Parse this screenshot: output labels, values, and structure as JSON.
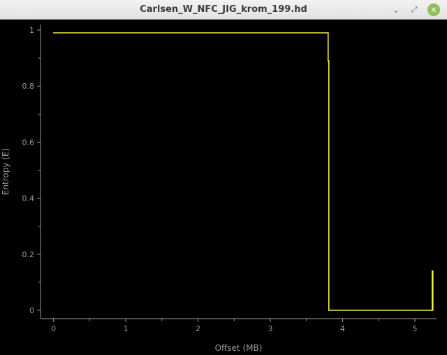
{
  "window": {
    "title": "Carlsen_W_NFC_JIG_krom_199.hd",
    "minimize_glyph": "⌄",
    "maximize_glyph": "⤢",
    "close_glyph": "✕"
  },
  "colors": {
    "background": "#000000",
    "axis": "#9a9a9a",
    "text": "#9a9a9a",
    "series": "#f2ec3c",
    "close_button": "#8fbf55"
  },
  "chart_data": {
    "type": "line",
    "title": "",
    "xlabel": "Offset (MB)",
    "ylabel": "Entropy (E)",
    "xlim": [
      -0.18,
      5.3
    ],
    "ylim": [
      -0.03,
      1.02
    ],
    "x_ticks": [
      0,
      1,
      2,
      3,
      4,
      5
    ],
    "x_tick_labels": [
      "0",
      "1",
      "2",
      "3",
      "4",
      "5"
    ],
    "y_ticks": [
      0,
      0.2,
      0.4,
      0.6,
      0.8,
      1
    ],
    "y_tick_labels": [
      "0",
      "0.2",
      "0.4",
      "0.6",
      "0.8",
      "1"
    ],
    "grid": false,
    "legend": "none",
    "series": [
      {
        "x": [
          0,
          3.8,
          3.8,
          3.81,
          3.81,
          5.24,
          5.24,
          5.25,
          5.25
        ],
        "y": [
          0.99,
          0.99,
          0.89,
          0.89,
          0.0,
          0.0,
          0.14,
          0.14,
          0.0
        ]
      }
    ]
  }
}
